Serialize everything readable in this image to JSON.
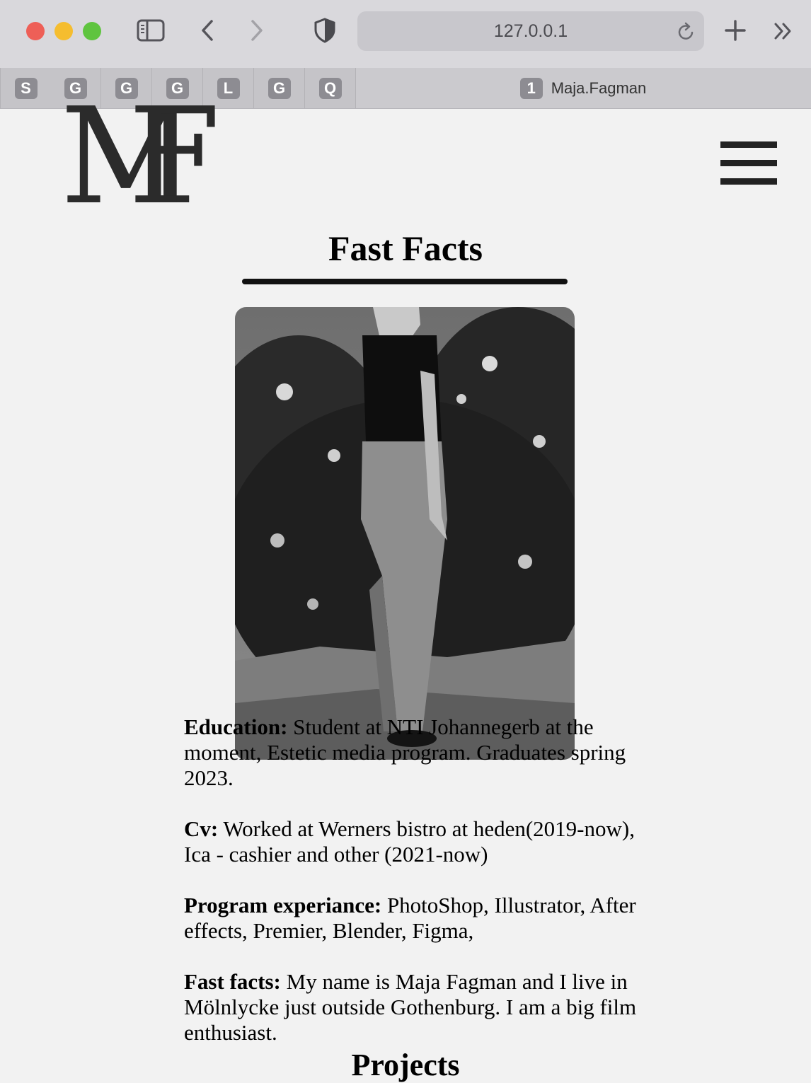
{
  "browser": {
    "url": "127.0.0.1",
    "pinned_tabs": [
      "S",
      "G",
      "G",
      "G",
      "L",
      "G",
      "Q"
    ],
    "active_tab": {
      "badge": "1",
      "title": "Maja.Fagman"
    },
    "icons": [
      "sidebar-icon",
      "back-icon",
      "forward-icon",
      "shield-icon",
      "reload-icon",
      "new-tab-icon",
      "overflow-icon"
    ]
  },
  "site": {
    "logo": {
      "m": "M",
      "f": "F"
    },
    "menu_icon": "hamburger-menu-icon"
  },
  "fast_facts": {
    "title": "Fast Facts",
    "items": [
      {
        "label": "Education:",
        "text": " Student at NTI Johannegerb at the moment, Estetic media program. Graduates spring 2023."
      },
      {
        "label": "Cv:",
        "text": " Worked at Werners bistro at heden(2019-now), Ica - cashier and other (2021-now)"
      },
      {
        "label": "Program experiance:",
        "text": " PhotoShop, Illustrator, After effects, Premier, Blender, Figma,"
      },
      {
        "label": "Fast facts:",
        "text": " My name is Maja Fagman and I live in Mölnlycke just outside Gothenburg. I am a big film enthusiast."
      }
    ]
  },
  "projects": {
    "title": "Projects"
  }
}
